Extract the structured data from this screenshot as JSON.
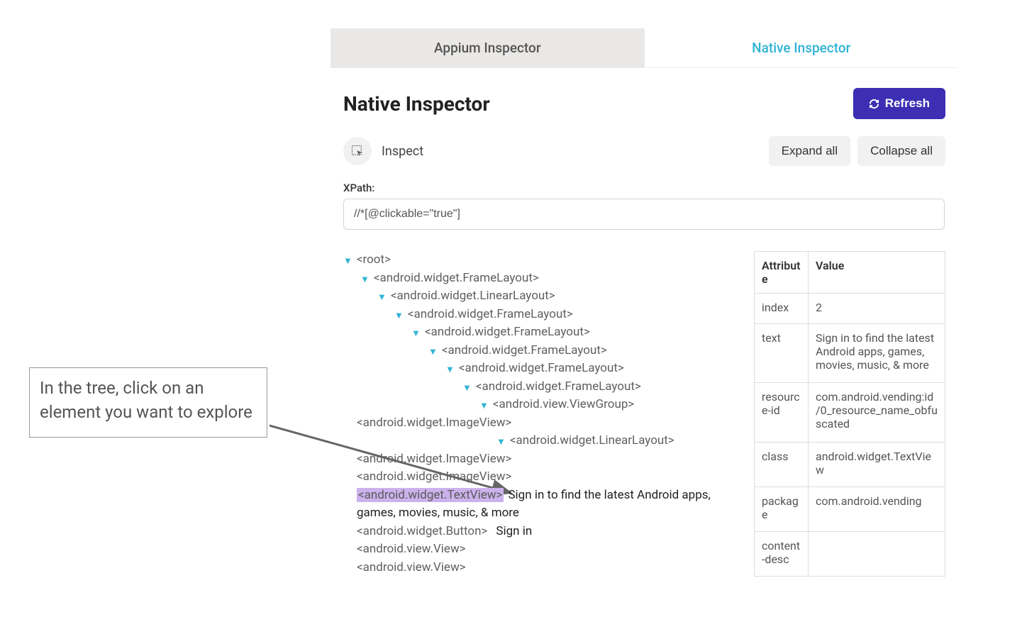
{
  "annotation": {
    "text": "In the tree, click on an element you want to explore"
  },
  "tabs": {
    "inactive": "Appium Inspector",
    "active": "Native Inspector"
  },
  "header": {
    "title": "Native Inspector",
    "refresh": "Refresh"
  },
  "toolbar": {
    "inspect": "Inspect",
    "expand_all": "Expand all",
    "collapse_all": "Collapse all"
  },
  "xpath": {
    "label": "XPath:",
    "value": "//*[@clickable=\"true\"]"
  },
  "tree": {
    "n0": "<root>",
    "n1": "<android.widget.FrameLayout>",
    "n2": "<android.widget.LinearLayout>",
    "n3": "<android.widget.FrameLayout>",
    "n4": "<android.widget.FrameLayout>",
    "n5": "<android.widget.FrameLayout>",
    "n6": "<android.widget.FrameLayout>",
    "n7": "<android.widget.FrameLayout>",
    "n8": "<android.view.ViewGroup>",
    "n9": "<android.widget.ImageView>",
    "n10": "<android.widget.LinearLayout>",
    "n11": "<android.widget.ImageView>",
    "n12": "<android.widget.ImageView>",
    "n13": "<android.widget.TextView>",
    "n13_text": "Sign in to find the latest Android apps, games, movies, music, & more",
    "n14": "<android.widget.Button>",
    "n14_text": "Sign in",
    "n15": "<android.view.View>",
    "n16": "<android.view.View>"
  },
  "attributes": {
    "header_attr": "Attribute",
    "header_val": "Value",
    "rows": [
      {
        "k": "index",
        "v": "2"
      },
      {
        "k": "text",
        "v": "Sign in to find the latest Android apps, games, movies, music, & more"
      },
      {
        "k": "resource-id",
        "v": "com.android.vending:id/0_resource_name_obfuscated"
      },
      {
        "k": "class",
        "v": "android.widget.TextView"
      },
      {
        "k": "package",
        "v": "com.android.vending"
      },
      {
        "k": "content-desc",
        "v": ""
      }
    ]
  }
}
